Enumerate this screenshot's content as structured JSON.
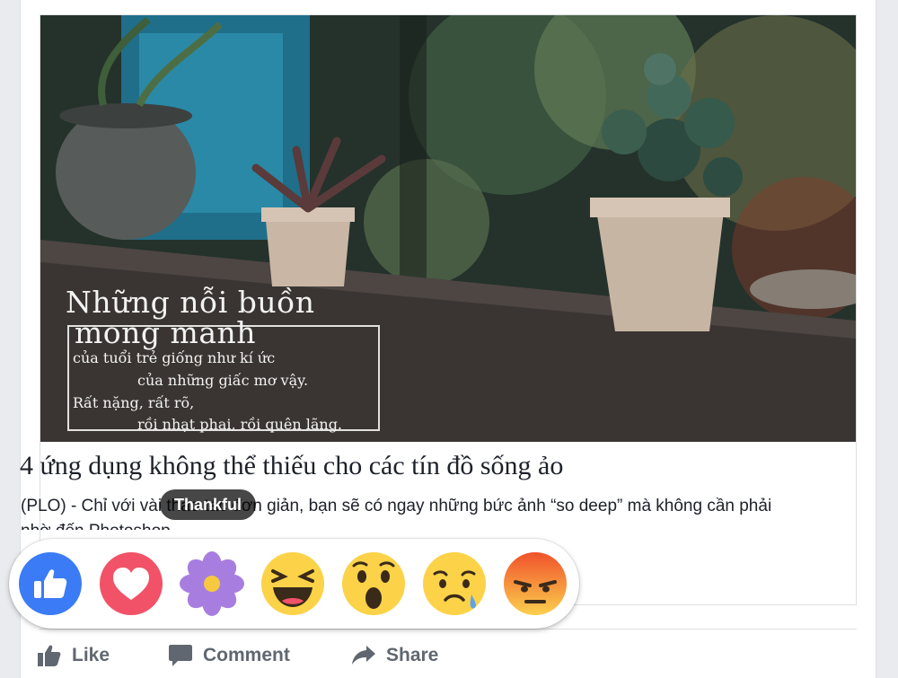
{
  "post": {
    "image": {
      "overlay_title_line1": "Những nỗi buồn",
      "overlay_title_line2": "mong manh",
      "overlay_line3": "của tuổi trẻ giống như kí ức",
      "overlay_line4": "của những giấc mơ vậy.",
      "overlay_line5": "Rất nặng, rất rõ,",
      "overlay_line6": "rồi nhạt phai, rồi quên lãng."
    },
    "headline": "4 ứng dụng không thể thiếu cho các tín đồ sống ảo",
    "description": "(PLO) - Chỉ với vài thao tác đơn giản, bạn sẽ có ngay những bức ảnh “so deep” mà không cần phải nhờ đến Photoshop"
  },
  "reactions": {
    "items": [
      {
        "name": "Like",
        "icon": "like-reaction-icon",
        "color": "#3b7bf5"
      },
      {
        "name": "Love",
        "icon": "love-reaction-icon",
        "color": "#f25268"
      },
      {
        "name": "Thankful",
        "icon": "flower-reaction-icon",
        "color": "#a77ee0"
      },
      {
        "name": "Haha",
        "icon": "haha-reaction-icon",
        "color": "#fcd248"
      },
      {
        "name": "Wow",
        "icon": "wow-reaction-icon",
        "color": "#fcd248"
      },
      {
        "name": "Sad",
        "icon": "sad-reaction-icon",
        "color": "#fcd248"
      },
      {
        "name": "Angry",
        "icon": "angry-reaction-icon",
        "color": "#f26b3a"
      }
    ],
    "tooltip": "Thankful"
  },
  "actions": {
    "like_label": "Like",
    "comment_label": "Comment",
    "share_label": "Share"
  },
  "colors": {
    "text": "#1d2129",
    "action_text": "#606770",
    "border": "#dddfe2",
    "page_bg": "#e9ebee"
  }
}
